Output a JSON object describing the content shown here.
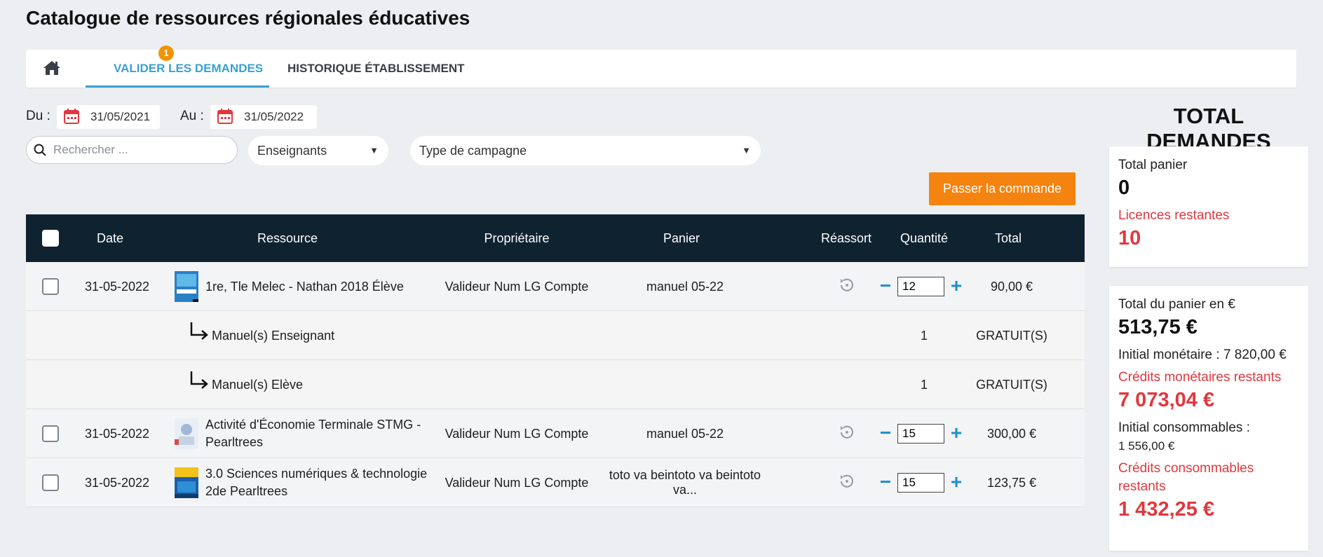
{
  "page": {
    "title": "Catalogue de ressources régionales éducatives"
  },
  "tabs": {
    "home_icon": "home-icon",
    "badge": "1",
    "validate_label": "VALIDER LES DEMANDES",
    "history_label": "HISTORIQUE ÉTABLISSEMENT",
    "active": "validate"
  },
  "filters": {
    "from_label": "Du :",
    "from_date": "31/05/2021",
    "to_label": "Au :",
    "to_date": "31/05/2022",
    "search_placeholder": "Rechercher ...",
    "teachers_select": "Enseignants",
    "campaign_select": "Type de campagne"
  },
  "actions": {
    "order_button": "Passer la commande"
  },
  "table": {
    "headers": [
      "Date",
      "Ressource",
      "Propriétaire",
      "Panier",
      "Réassort",
      "Quantité",
      "Total"
    ],
    "rows": [
      {
        "date": "31-05-2022",
        "resource": "1re, Tle Melec - Nathan 2018 Élève",
        "owner": "Valideur Num LG Compte",
        "cart": "manuel 05-22",
        "quantity": "12",
        "total": "90,00 €"
      },
      {
        "date": "31-05-2022",
        "resource": "Activité d'Économie Terminale STMG - Pearltrees",
        "owner": "Valideur Num LG Compte",
        "cart": "manuel 05-22",
        "quantity": "15",
        "total": "300,00 €"
      },
      {
        "date": "31-05-2022",
        "resource": "3.0 Sciences numériques & technologie 2de Pearltrees",
        "owner": "Valideur Num LG Compte",
        "cart": "toto va beintoto va beintoto va...",
        "quantity": "15",
        "total": "123,75 €"
      }
    ],
    "subrows": [
      {
        "label": "Manuel(s) Enseignant",
        "quantity": "1",
        "total": "GRATUIT(S)"
      },
      {
        "label": "Manuel(s) Elève",
        "quantity": "1",
        "total": "GRATUIT(S)"
      }
    ]
  },
  "summary": {
    "title": "TOTAL DEMANDES",
    "cart_total_label": "Total panier",
    "cart_total_value": "0",
    "licences_label": "Licences restantes",
    "licences_value": "10",
    "cart_eur_label": "Total du panier en €",
    "cart_eur_value": "513,75 €",
    "initial_monetary": "Initial monétaire : 7 820,00 €",
    "monetary_credits_label": "Crédits monétaires restants",
    "monetary_credits_value": "7 073,04 €",
    "initial_consumables_label": "Initial consommables :",
    "initial_consumables_value": "1 556,00 €",
    "consumable_credits_label": "Crédits consommables restants",
    "consumable_credits_value": "1 432,25 €"
  },
  "colors": {
    "accent": "#3aa0d0",
    "orange": "#f5830f",
    "header_dark": "#0f2230",
    "red": "#e0383e"
  }
}
